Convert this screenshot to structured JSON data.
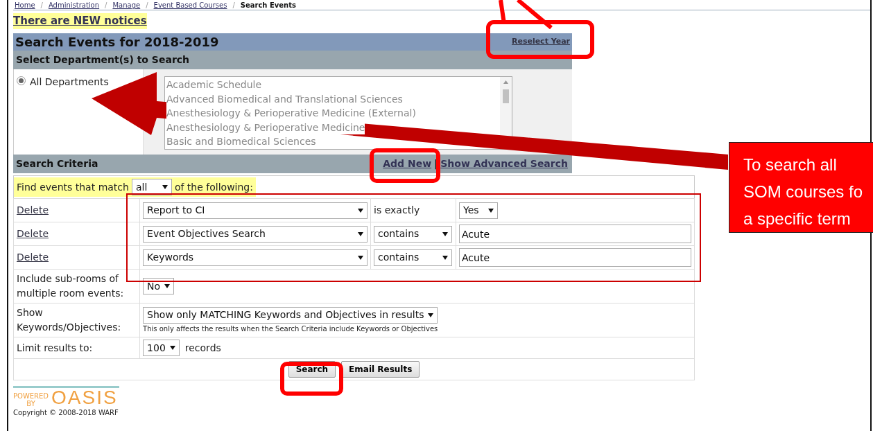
{
  "breadcrumb": [
    {
      "kind": "link",
      "text": "Home"
    },
    {
      "kind": "separator",
      "text": "/"
    },
    {
      "kind": "link",
      "text": "Administration"
    },
    {
      "kind": "separator",
      "text": "/"
    },
    {
      "kind": "link",
      "text": "Manage"
    },
    {
      "kind": "separator",
      "text": "/"
    },
    {
      "kind": "link",
      "text": "Event Based Courses"
    },
    {
      "kind": "separator",
      "text": "/"
    },
    {
      "kind": "current",
      "text": "Search Events"
    }
  ],
  "notice_link": "There are NEW notices",
  "header": {
    "title": "Search Events for 2018-2019",
    "reselect_link": "Reselect Year"
  },
  "departments": {
    "heading": "Select Department(s) to Search",
    "all_option": {
      "label": "All Departments",
      "selected": true
    },
    "list_disabled": true,
    "list": [
      "Academic Schedule",
      "Advanced Biomedical and Translational Sciences",
      "Anesthesiology & Perioperative Medicine (External)",
      "Anesthesiology & Perioperative Medicine",
      "Basic and Biomedical Sciences"
    ]
  },
  "criteria": {
    "heading": "Search Criteria",
    "links": [
      {
        "kind": "link",
        "text": "Add New"
      },
      {
        "kind": "separator",
        "text": "|"
      },
      {
        "kind": "link",
        "text": "Show Advanced Search"
      }
    ],
    "match_prefix": "Find events that match",
    "match_value": "all",
    "match_suffix": "of the following:",
    "rows": [
      {
        "delete": "Delete",
        "field": "Report to CI",
        "operator": {
          "kind": "text",
          "text": "is exactly"
        },
        "value": {
          "kind": "select",
          "text": "Yes"
        }
      },
      {
        "delete": "Delete",
        "field": "Event Objectives Search",
        "operator": {
          "kind": "select",
          "text": "contains"
        },
        "value": {
          "kind": "input",
          "text": "Acute"
        }
      },
      {
        "delete": "Delete",
        "field": "Keywords",
        "operator": {
          "kind": "select",
          "text": "contains"
        },
        "value": {
          "kind": "input",
          "text": "Acute"
        }
      }
    ]
  },
  "options": [
    {
      "label": "Include sub-rooms of multiple room events:",
      "select": "No"
    },
    {
      "label": "Show Keywords/Objectives:",
      "select": "Show only MATCHING Keywords and Objectives in results",
      "note": "This only affects the results when the Search Criteria include Keywords or Objectives"
    },
    {
      "label": "Limit results to:",
      "select": "100",
      "suffix": "records"
    }
  ],
  "buttons": [
    "Search",
    "Email Results"
  ],
  "footer": {
    "powered": "POWERED",
    "by": "BY",
    "logo": "OASIS",
    "copyright": "Copyright © 2008-2018 WARF"
  },
  "callout": {
    "lines": [
      "To search all",
      "SOM courses fo",
      "a specific term"
    ]
  }
}
